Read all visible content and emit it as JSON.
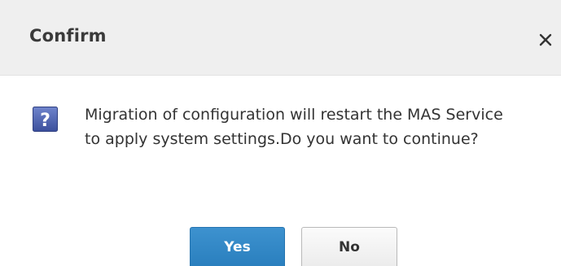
{
  "dialog": {
    "title": "Confirm",
    "close_glyph": "✕",
    "icon": "question-icon",
    "icon_glyph": "?",
    "message": "Migration of configuration will restart the MAS Service to apply system settings.Do you want to continue?",
    "buttons": {
      "yes_label": "Yes",
      "no_label": "No"
    },
    "colors": {
      "primary_button": "#2a7fbe",
      "icon": "#4a5fae",
      "header_bg": "#efefef"
    }
  }
}
